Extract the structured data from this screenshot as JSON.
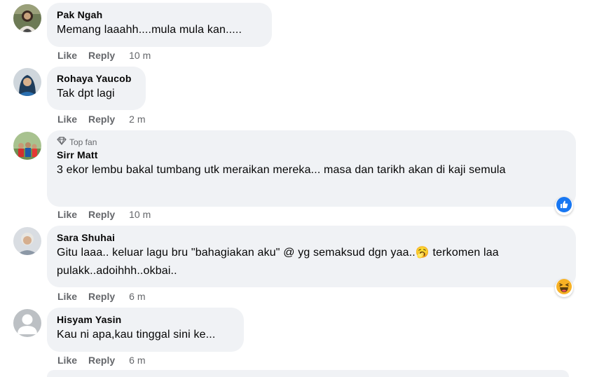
{
  "comments": [
    {
      "name": "Pak Ngah",
      "text": "Memang laaahh....mula mula kan.....",
      "like": "Like",
      "reply": "Reply",
      "time": "10 m"
    },
    {
      "name": "Rohaya Yaucob",
      "text": "Tak dpt lagi",
      "like": "Like",
      "reply": "Reply",
      "time": "2 m"
    },
    {
      "badge": "Top fan",
      "name": "Sirr Matt",
      "text": "3 ekor lembu bakal tumbang utk meraikan mereka... masa dan tarikh akan di kaji semula",
      "like": "Like",
      "reply": "Reply",
      "time": "10 m",
      "reaction": "like-reaction"
    },
    {
      "name": "Sara Shuhai",
      "text": "Gitu laaa.. keluar lagu bru \"bahagiakan aku\" @ yg semaksud dgn yaa..🥱 terkomen laa pulakk..adoihhh..okbai..",
      "like": "Like",
      "reply": "Reply",
      "time": "6 m",
      "reaction": "haha-reaction"
    },
    {
      "name": "Hisyam Yasin",
      "text": "Kau ni apa,kau tinggal sini ke...",
      "like": "Like",
      "reply": "Reply",
      "time": "6 m"
    }
  ],
  "colors": {
    "bubble": "#f0f2f5",
    "meta": "#65676b",
    "like_blue": "#1877f2",
    "haha_yellow": "#f7b125"
  }
}
